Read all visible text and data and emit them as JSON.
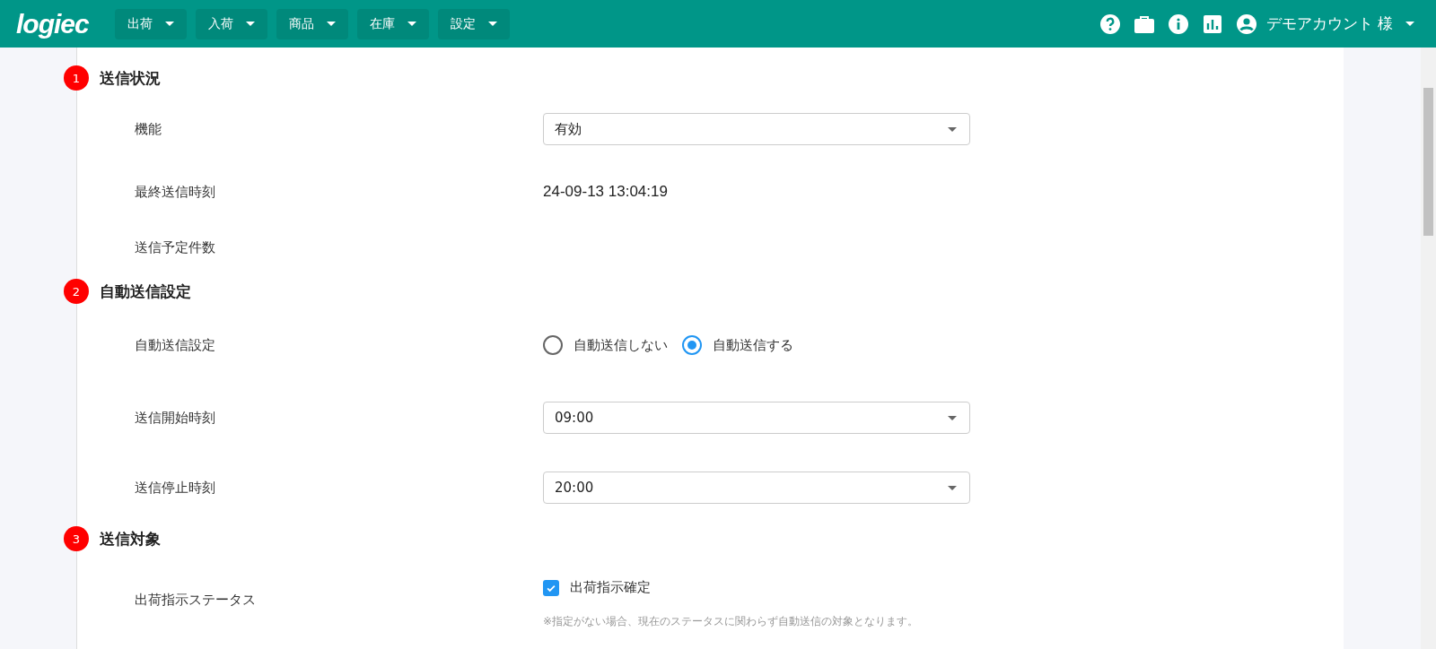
{
  "header": {
    "logo": "logiec",
    "nav": [
      {
        "label": "出荷"
      },
      {
        "label": "入荷"
      },
      {
        "label": "商品"
      },
      {
        "label": "在庫"
      },
      {
        "label": "設定"
      }
    ],
    "account": "デモアカウント 様"
  },
  "sections": [
    {
      "number": "1",
      "title": "送信状況",
      "rows": [
        {
          "kind": "select",
          "label": "機能",
          "value": "有効"
        },
        {
          "kind": "text",
          "label": "最終送信時刻",
          "value": "24-09-13 13:04:19"
        },
        {
          "kind": "text",
          "label": "送信予定件数"
        }
      ]
    },
    {
      "number": "2",
      "title": "自動送信設定",
      "rows": [
        {
          "kind": "radio",
          "label": "自動送信設定",
          "options": [
            {
              "label": "自動送信しない",
              "selected": false
            },
            {
              "label": "自動送信する",
              "selected": true
            }
          ]
        },
        {
          "kind": "select",
          "label": "送信開始時刻",
          "value": "09:00"
        },
        {
          "kind": "select",
          "label": "送信停止時刻",
          "value": "20:00"
        }
      ]
    },
    {
      "number": "3",
      "title": "送信対象",
      "rows": [
        {
          "kind": "checkbox",
          "label": "出荷指示ステータス",
          "options": [
            {
              "label": "出荷指示確定",
              "checked": true
            }
          ],
          "note": "※指定がない場合、現在のステータスに関わらず自動送信の対象となります。"
        }
      ]
    }
  ]
}
